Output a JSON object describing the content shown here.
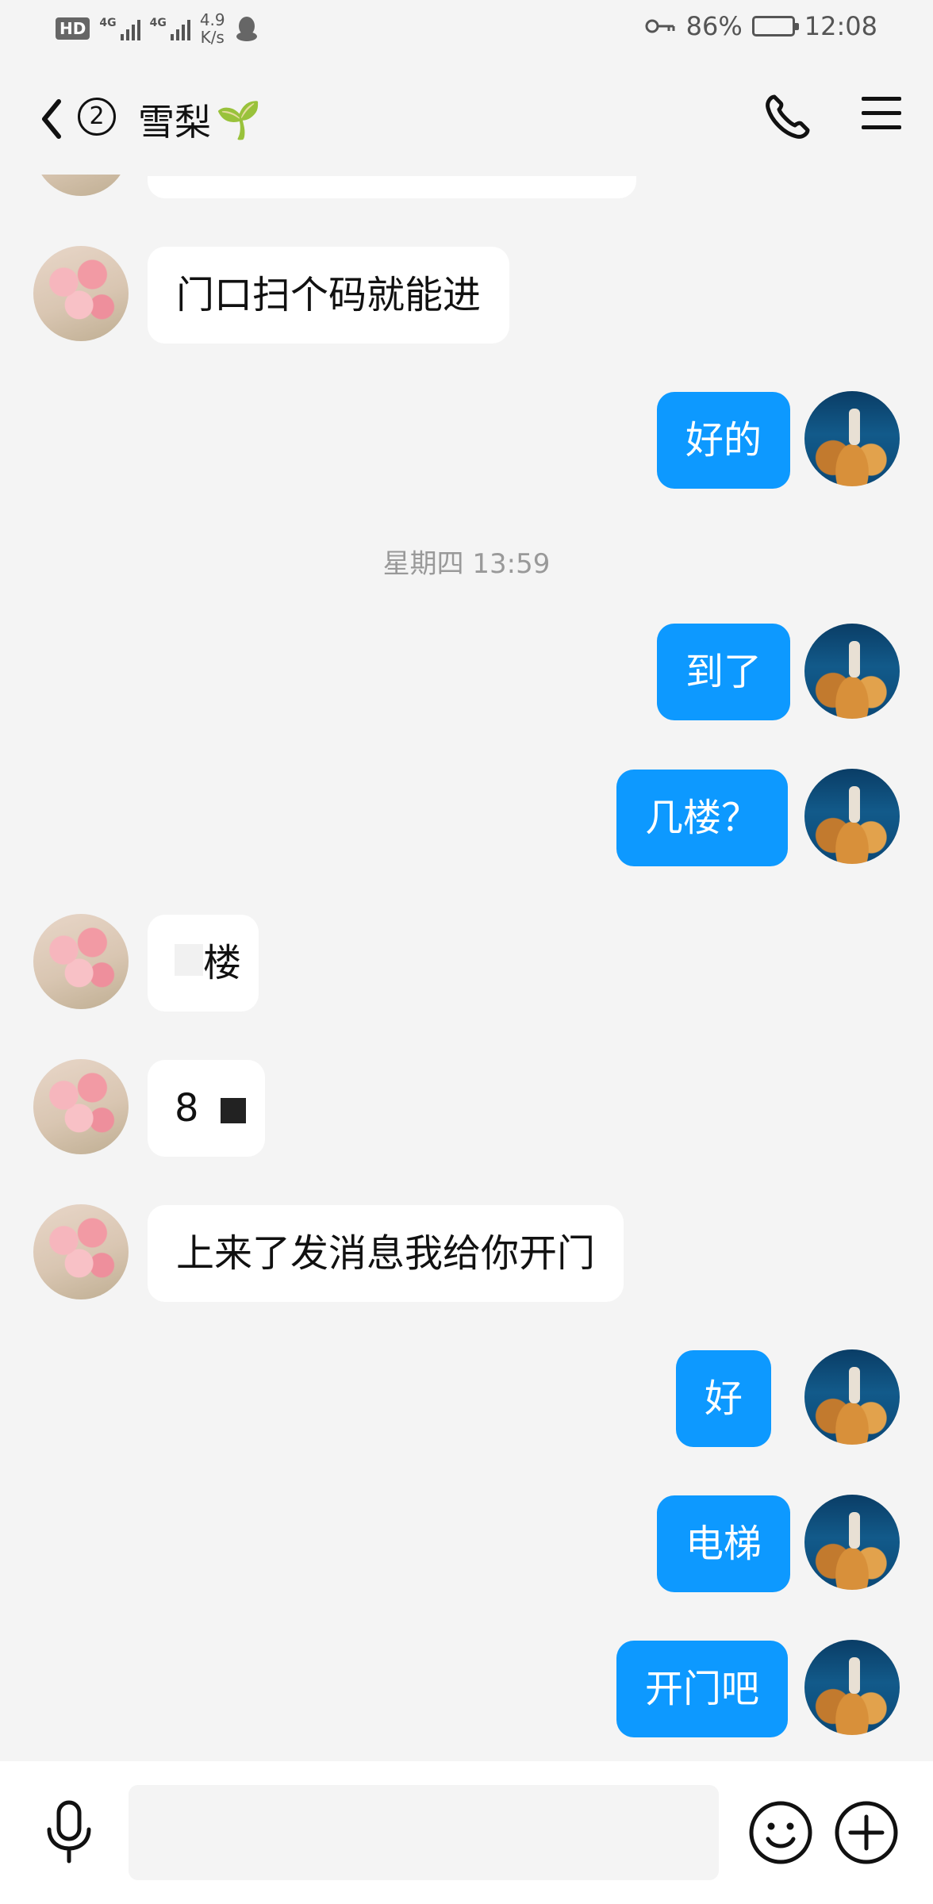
{
  "status_bar": {
    "hd": "HD",
    "sim1": "4G",
    "sim2": "4G",
    "speed_value": "4.9",
    "speed_unit": "K/s",
    "battery": "86%",
    "battery_level": 0.86,
    "time": "12:08",
    "icons": [
      "qq-penguin-icon",
      "key-icon",
      "battery-icon"
    ]
  },
  "header": {
    "unread_count": "2",
    "title": "雪梨",
    "title_emoji": "🌱",
    "icons": [
      "back-chevron-icon",
      "phone-icon",
      "menu-icon"
    ]
  },
  "messages": [
    {
      "side": "in",
      "text": "门口扫个码就能进"
    },
    {
      "side": "out",
      "text": "好的"
    },
    {
      "side": "out",
      "text": "到了"
    },
    {
      "side": "out",
      "text": "几楼？"
    },
    {
      "side": "in",
      "text": "楼"
    },
    {
      "side": "in",
      "text": "8"
    },
    {
      "side": "in",
      "text": "上来了发消息我给你开门"
    },
    {
      "side": "out",
      "text": "好"
    },
    {
      "side": "out",
      "text": "电梯"
    },
    {
      "side": "out",
      "text": "开门吧"
    }
  ],
  "time_separator": "星期四 13:59",
  "input_bar": {
    "placeholder": "",
    "icons": [
      "microphone-icon",
      "emoji-icon",
      "plus-icon"
    ]
  },
  "colors": {
    "background": "#f4f4f4",
    "incoming_bubble": "#ffffff",
    "outgoing_bubble": "#0d99ff",
    "outgoing_text": "#ffffff",
    "timestamp": "#999999"
  }
}
